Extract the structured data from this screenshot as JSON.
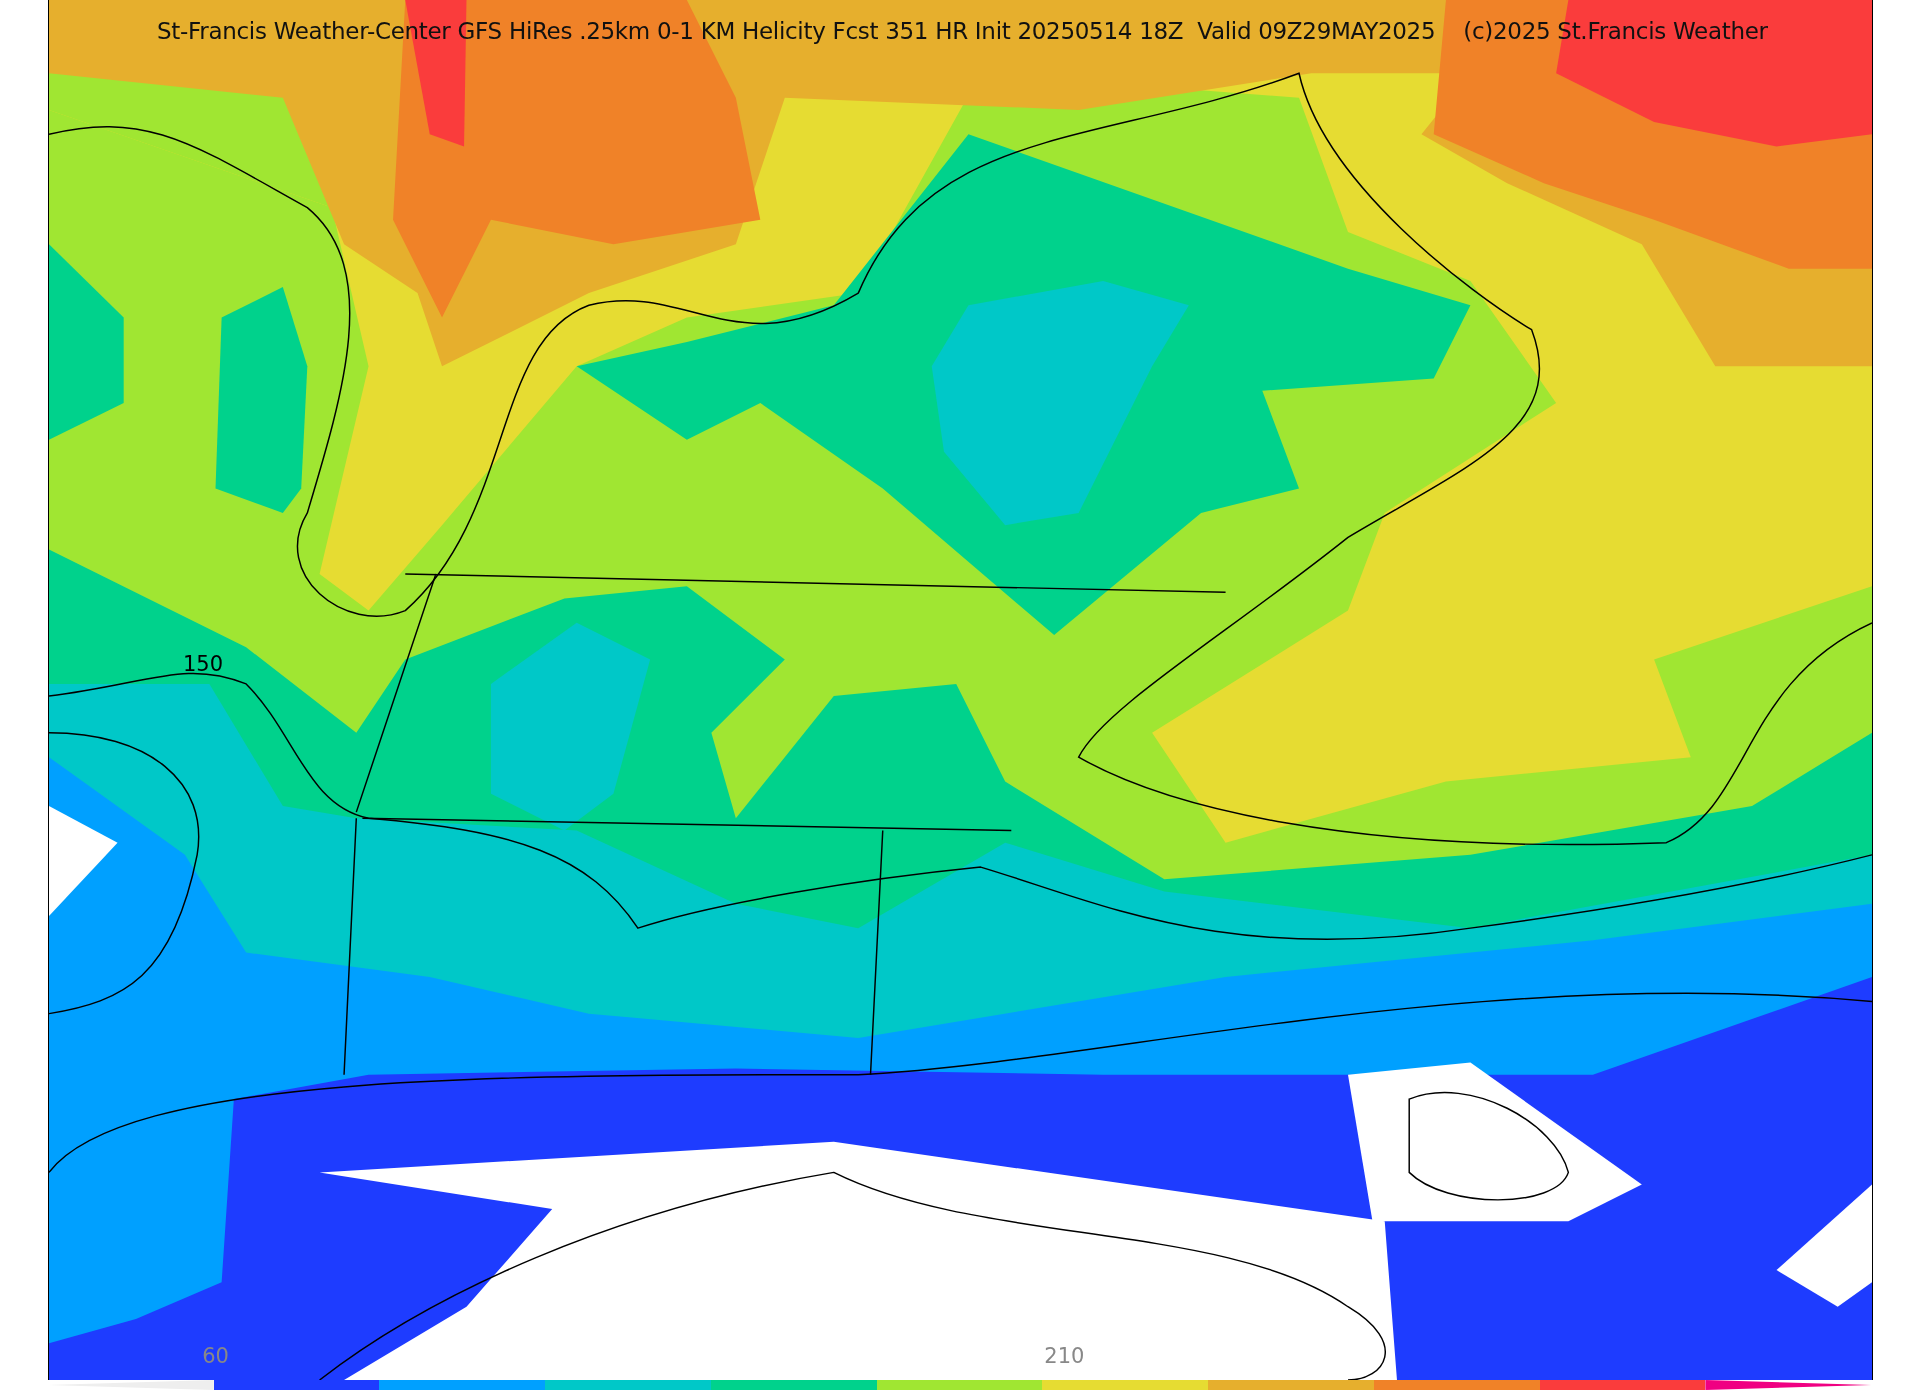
{
  "map": {
    "title": "St-Francis Weather-Center GFS HiRes .25km 0-1 KM Helicity Fcst 351 HR Init 20250514 18Z  Valid 09Z29MAY2025    (c)2025 St.Francis Weather",
    "contour_labels": [
      "150"
    ]
  },
  "colorbar": {
    "tick_labels": [
      "60",
      "210"
    ],
    "segments": [
      {
        "color": "#ffffff"
      },
      {
        "color": "#1e3cff"
      },
      {
        "color": "#00a0ff"
      },
      {
        "color": "#00c8c8"
      },
      {
        "color": "#00d28c"
      },
      {
        "color": "#a0e632"
      },
      {
        "color": "#e6dc32"
      },
      {
        "color": "#e6af2d"
      },
      {
        "color": "#f08228"
      },
      {
        "color": "#fa3c3c"
      },
      {
        "color": "#f00082"
      }
    ]
  }
}
